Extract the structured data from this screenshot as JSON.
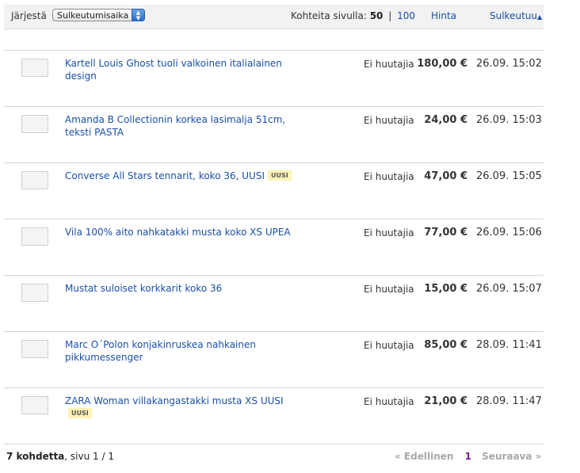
{
  "toolbar": {
    "sort_label": "Järjestä",
    "sort_value": "Sulkeutumisaika",
    "per_page_label": "Kohteita sivulla:",
    "per_page_current": "50",
    "per_page_separator": "|",
    "per_page_alt": "100",
    "price_header": "Hinta",
    "closing_header": "Sulkeutuu",
    "closing_sort_indicator": "▲"
  },
  "items": [
    {
      "title": "Kartell Louis Ghost tuoli valkoinen italialainen design",
      "badge": "",
      "bids": "Ei huutajia",
      "price": "180,00 €",
      "closes": "26.09. 15:02"
    },
    {
      "title": "Amanda B Collectionin korkea lasimalja 51cm, teksti PASTA",
      "badge": "",
      "bids": "Ei huutajia",
      "price": "24,00 €",
      "closes": "26.09. 15:03"
    },
    {
      "title": "Converse All Stars tennarit, koko 36, UUSI",
      "badge": "UUSI",
      "bids": "Ei huutajia",
      "price": "47,00 €",
      "closes": "26.09. 15:05"
    },
    {
      "title": "Vila 100% aito nahkatakki musta koko XS UPEA",
      "badge": "",
      "bids": "Ei huutajia",
      "price": "77,00 €",
      "closes": "26.09. 15:06"
    },
    {
      "title": "Mustat suloiset korkkarit koko 36",
      "badge": "",
      "bids": "Ei huutajia",
      "price": "15,00 €",
      "closes": "26.09. 15:07"
    },
    {
      "title": "Marc O´Polon konjakinruskea nahkainen pikkumessenger",
      "badge": "",
      "bids": "Ei huutajia",
      "price": "85,00 €",
      "closes": "28.09. 11:41"
    },
    {
      "title": "ZARA Woman villakangastakki musta XS UUSI",
      "badge": "UUSI",
      "bids": "Ei huutajia",
      "price": "21,00 €",
      "closes": "28.09. 11:47"
    }
  ],
  "footer": {
    "count_bold": "7 kohdetta",
    "count_rest": ", sivu 1 / 1",
    "prev": "« Edellinen",
    "page": "1",
    "next": "Seuraava »"
  },
  "colors": {
    "link": "#1a4fa8",
    "badge_bg": "#fdf3b6",
    "current_page": "#7a1f8c",
    "disabled": "#a8a8a8"
  }
}
